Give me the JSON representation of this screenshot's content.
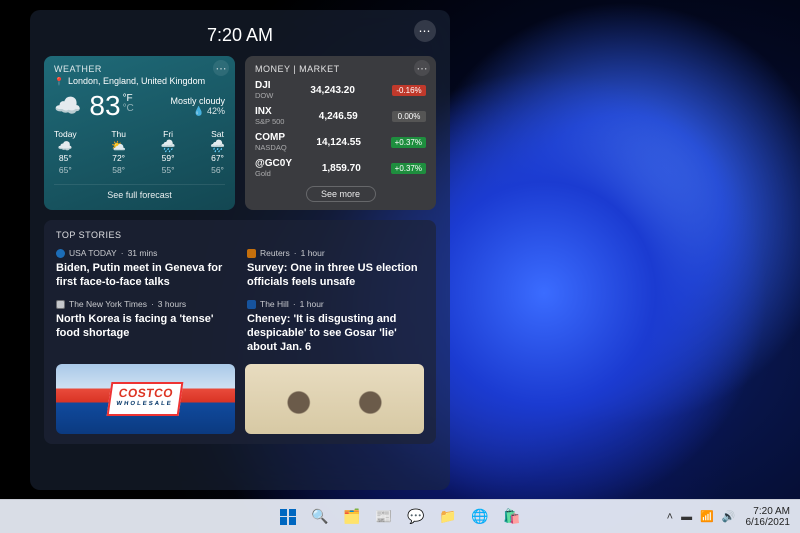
{
  "panel": {
    "time": "7:20 AM"
  },
  "weather": {
    "title": "WEATHER",
    "location": "London, England, United Kingdom",
    "temp": "83",
    "unit_top": "°F",
    "unit_bottom": "°C",
    "condition": "Mostly cloudy",
    "rain_chance": "42%",
    "forecast": [
      {
        "day": "Today",
        "icon": "☁️",
        "hi": "85°",
        "lo": "65°"
      },
      {
        "day": "Thu",
        "icon": "⛅",
        "hi": "72°",
        "lo": "58°"
      },
      {
        "day": "Fri",
        "icon": "🌧️",
        "hi": "59°",
        "lo": "55°"
      },
      {
        "day": "Sat",
        "icon": "🌧️",
        "hi": "67°",
        "lo": "56°"
      }
    ],
    "footer": "See full forecast"
  },
  "money": {
    "title": "MONEY | MARKET",
    "tickers": [
      {
        "sym": "DJI",
        "sub": "DOW",
        "price": "34,243.20",
        "delta": "-0.16%",
        "dir": "neg"
      },
      {
        "sym": "INX",
        "sub": "S&P 500",
        "price": "4,246.59",
        "delta": "0.00%",
        "dir": "flat"
      },
      {
        "sym": "COMP",
        "sub": "NASDAQ",
        "price": "14,124.55",
        "delta": "+0.37%",
        "dir": "pos"
      },
      {
        "sym": "@GC0Y",
        "sub": "Gold",
        "price": "1,859.70",
        "delta": "+0.37%",
        "dir": "pos"
      }
    ],
    "footer": "See more"
  },
  "stories": {
    "title": "TOP STORIES",
    "items": [
      {
        "source": "USA TODAY",
        "age": "31 mins",
        "color": "#1e88e5",
        "headline": "Biden, Putin meet in Geneva for first face-to-face talks"
      },
      {
        "source": "Reuters",
        "age": "1 hour",
        "color": "#ff8a00",
        "headline": "Survey: One in three US election officials feels unsafe"
      },
      {
        "source": "The New York Times",
        "age": "3 hours",
        "color": "#ffffff",
        "headline": "North Korea is facing a 'tense' food shortage"
      },
      {
        "source": "The Hill",
        "age": "1 hour",
        "color": "#1565c0",
        "headline": "Cheney: 'It is disgusting and despicable' to see Gosar 'lie' about Jan. 6"
      }
    ]
  },
  "image_tiles": {
    "costco_text_main": "COSTCO",
    "costco_text_sub": "WHOLESALE"
  },
  "taskbar": {
    "tray_time": "7:20 AM",
    "tray_date": "6/16/2021"
  }
}
